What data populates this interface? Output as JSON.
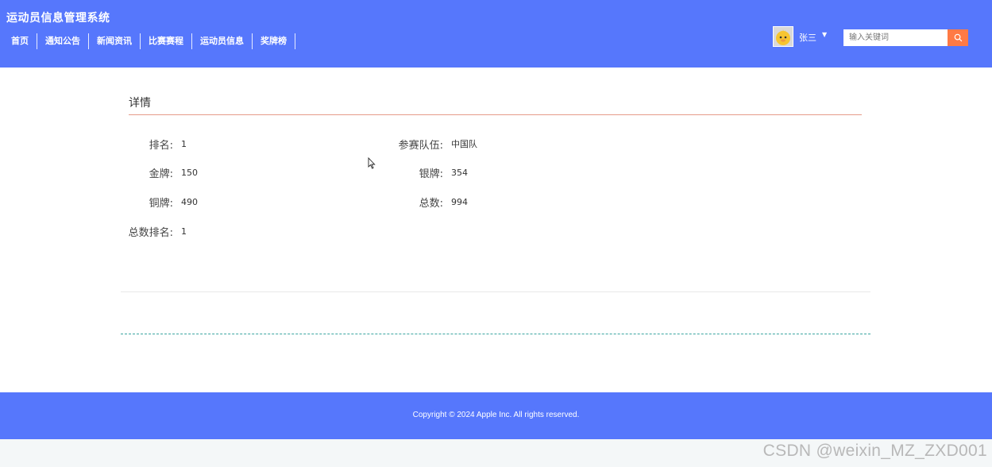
{
  "header": {
    "site_title": "运动员信息管理系统",
    "nav": [
      "首页",
      "通知公告",
      "新闻资讯",
      "比赛赛程",
      "运动员信息",
      "奖牌榜"
    ],
    "user": {
      "name": "张三",
      "avatar_icon": "cartoon-avatar-icon",
      "caret_icon": "caret-down-icon"
    },
    "search": {
      "placeholder": "输入关键词",
      "value": "",
      "button_icon": "search-icon",
      "button_color": "#ff7a45"
    },
    "color": "#5677fc"
  },
  "detail": {
    "title": "详情",
    "fields": {
      "rank": {
        "label": "排名:",
        "value": "1"
      },
      "team": {
        "label": "参赛队伍:",
        "value": "中国队"
      },
      "gold": {
        "label": "金牌:",
        "value": "150"
      },
      "silver": {
        "label": "银牌:",
        "value": "354"
      },
      "bronze": {
        "label": "铜牌:",
        "value": "490"
      },
      "total": {
        "label": "总数:",
        "value": "994"
      },
      "total_rank": {
        "label": "总数排名:",
        "value": "1"
      }
    }
  },
  "footer": {
    "copyright": "Copyright © 2024 Apple Inc. All rights reserved."
  },
  "watermark": "CSDN @weixin_MZ_ZXD001"
}
